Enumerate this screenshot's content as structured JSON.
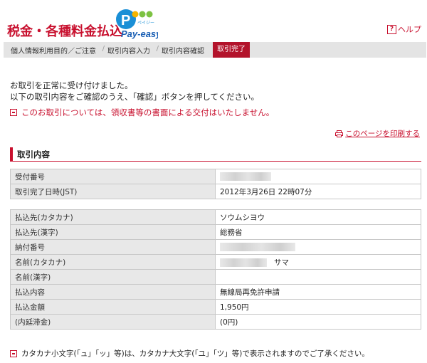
{
  "header": {
    "title": "税金・各種料金払込",
    "logo_text": "Pay-easy",
    "logo_small": "ペイジー",
    "help_label": "ヘルプ"
  },
  "steps": [
    {
      "label": "個人情報利用目的／ご注意",
      "active": false
    },
    {
      "label": "取引内容入力",
      "active": false
    },
    {
      "label": "取引内容確認",
      "active": false
    },
    {
      "label": "取引完了",
      "active": true
    }
  ],
  "messages": {
    "line1": "お取引を正常に受け付けました。",
    "line2": "以下の取引内容をご確認のうえ、「確認」ボタンを押してください。",
    "warning": "このお取引については、領収書等の書面による交付はいたしません。"
  },
  "print_link": "このページを印刷する",
  "section_title": "取引内容",
  "table1": [
    {
      "label": "受付番号",
      "value": "",
      "masked": true,
      "mask_w": 72
    },
    {
      "label": "取引完了日時(JST)",
      "value": "2012年3月26日 22時07分",
      "masked": false
    }
  ],
  "table2": [
    {
      "label": "払込先(カタカナ)",
      "value": "ソウムシヨウ",
      "masked": false
    },
    {
      "label": "払込先(漢字)",
      "value": "総務省",
      "masked": false
    },
    {
      "label": "納付番号",
      "value": "",
      "masked": true,
      "mask_w": 106
    },
    {
      "label": "名前(カタカナ)",
      "value": "サマ",
      "masked": true,
      "mask_w": 66
    },
    {
      "label": "名前(漢字)",
      "value": "",
      "masked": false
    },
    {
      "label": "払込内容",
      "value": "無線局再免許申請",
      "masked": false
    },
    {
      "label": "払込金額",
      "value": "1,950円",
      "masked": false
    },
    {
      "label": "(内延滞金)",
      "value": "(0円)",
      "masked": false
    }
  ],
  "footnote": "カタカナ小文字(「ュ」「ッ」等)は、カタカナ大文字(「ユ」「ツ」等)で表示されますのでご了承ください。",
  "colors": {
    "accent": "#c8102e",
    "step_active": "#b3132b",
    "label_bg": "#e8e8e8"
  }
}
